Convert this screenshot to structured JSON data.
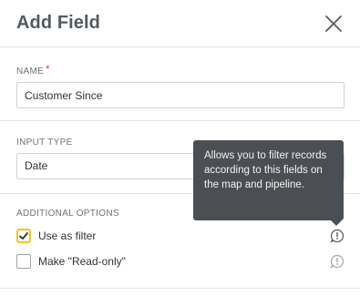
{
  "header": {
    "title": "Add Field"
  },
  "name_section": {
    "label": "NAME",
    "required_mark": "*",
    "value": "Customer Since"
  },
  "input_type_section": {
    "label": "INPUT TYPE",
    "selected": "Date"
  },
  "additional_options": {
    "label": "ADDITIONAL OPTIONS",
    "options": [
      {
        "label": "Use as filter",
        "checked": true
      },
      {
        "label": "Make \"Read-only\"",
        "checked": false
      }
    ]
  },
  "tooltip": {
    "text": "Allows you to filter records according to this fields on the map and pipeline."
  },
  "colors": {
    "focus_border": "#f5c518",
    "required": "#e0245e",
    "tooltip_bg": "#4b4f54"
  },
  "icons": {
    "close": "close-icon",
    "info": "info-icon",
    "check": "checkmark-icon"
  }
}
